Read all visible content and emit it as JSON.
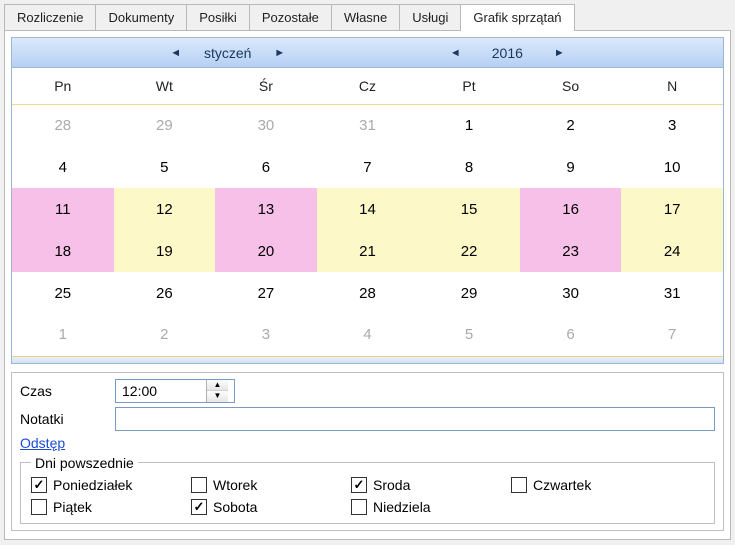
{
  "tabs": {
    "items": [
      {
        "label": "Rozliczenie",
        "active": false
      },
      {
        "label": "Dokumenty",
        "active": false
      },
      {
        "label": "Posiłki",
        "active": false
      },
      {
        "label": "Pozostałe",
        "active": false
      },
      {
        "label": "Własne",
        "active": false
      },
      {
        "label": "Usługi",
        "active": false
      },
      {
        "label": "Grafik sprzątań",
        "active": true
      }
    ]
  },
  "calendar": {
    "month_label": "styczeń",
    "year_label": "2016",
    "weekday_labels": [
      "Pn",
      "Wt",
      "Śr",
      "Cz",
      "Pt",
      "So",
      "N"
    ],
    "rows": [
      [
        {
          "d": "28",
          "out": true
        },
        {
          "d": "29",
          "out": true
        },
        {
          "d": "30",
          "out": true
        },
        {
          "d": "31",
          "out": true
        },
        {
          "d": "1"
        },
        {
          "d": "2"
        },
        {
          "d": "3"
        }
      ],
      [
        {
          "d": "4"
        },
        {
          "d": "5"
        },
        {
          "d": "6"
        },
        {
          "d": "7"
        },
        {
          "d": "8"
        },
        {
          "d": "9"
        },
        {
          "d": "10"
        }
      ],
      [
        {
          "d": "11",
          "hl": "pink"
        },
        {
          "d": "12",
          "hl": "yellow"
        },
        {
          "d": "13",
          "hl": "pink"
        },
        {
          "d": "14",
          "hl": "yellow"
        },
        {
          "d": "15",
          "hl": "yellow"
        },
        {
          "d": "16",
          "hl": "pink"
        },
        {
          "d": "17",
          "hl": "yellow"
        }
      ],
      [
        {
          "d": "18",
          "hl": "pink"
        },
        {
          "d": "19",
          "hl": "yellow"
        },
        {
          "d": "20",
          "hl": "pink"
        },
        {
          "d": "21",
          "hl": "yellow"
        },
        {
          "d": "22",
          "hl": "yellow"
        },
        {
          "d": "23",
          "hl": "pink"
        },
        {
          "d": "24",
          "hl": "yellow"
        }
      ],
      [
        {
          "d": "25"
        },
        {
          "d": "26"
        },
        {
          "d": "27"
        },
        {
          "d": "28"
        },
        {
          "d": "29"
        },
        {
          "d": "30"
        },
        {
          "d": "31"
        }
      ],
      [
        {
          "d": "1",
          "out": true
        },
        {
          "d": "2",
          "out": true
        },
        {
          "d": "3",
          "out": true
        },
        {
          "d": "4",
          "out": true
        },
        {
          "d": "5",
          "out": true
        },
        {
          "d": "6",
          "out": true
        },
        {
          "d": "7",
          "out": true
        }
      ]
    ]
  },
  "form": {
    "time_label": "Czas",
    "time_value": "12:00",
    "notes_label": "Notatki",
    "notes_value": "",
    "interval_link_label": "Odstęp",
    "weekdays_legend": "Dni powszednie",
    "weekdays": [
      {
        "label": "Poniedziałek",
        "checked": true
      },
      {
        "label": "Wtorek",
        "checked": false
      },
      {
        "label": "Sroda",
        "checked": true
      },
      {
        "label": "Czwartek",
        "checked": false
      },
      {
        "label": "Piątek",
        "checked": false
      },
      {
        "label": "Sobota",
        "checked": true
      },
      {
        "label": "Niedziela",
        "checked": false
      }
    ]
  }
}
